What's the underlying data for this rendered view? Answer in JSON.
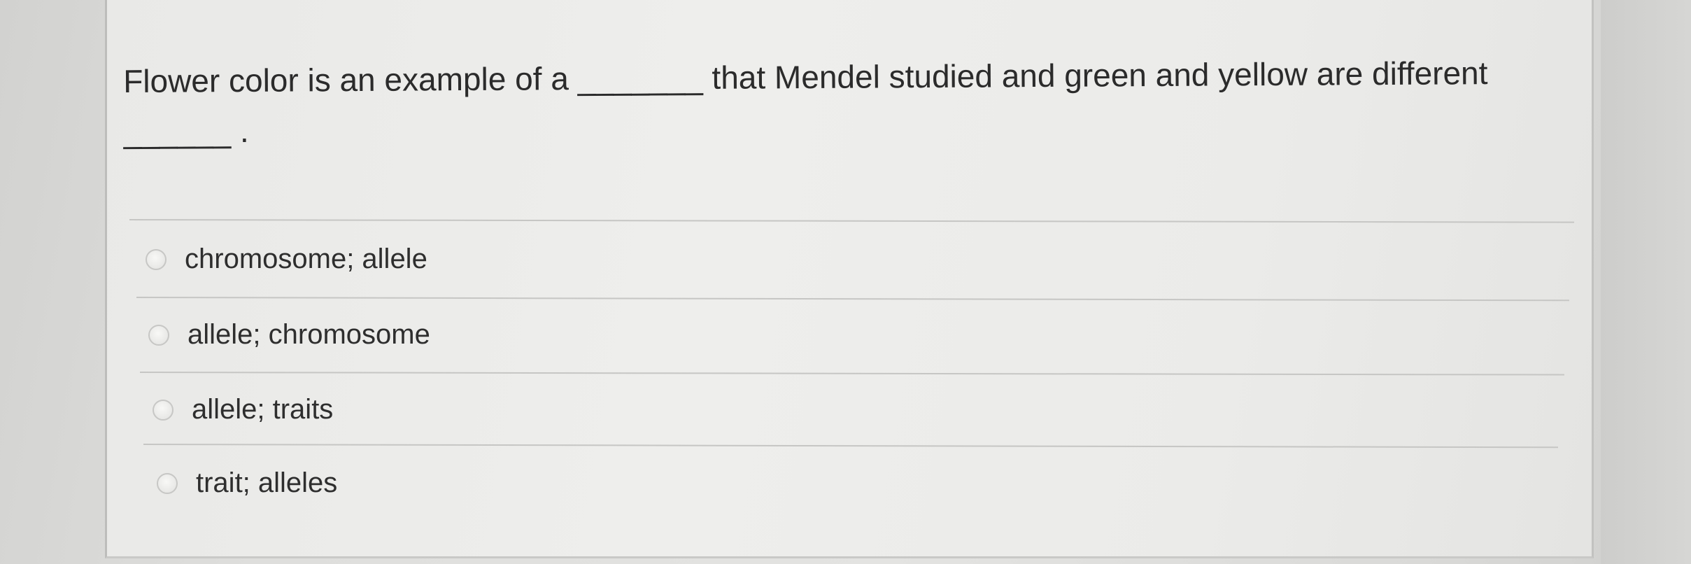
{
  "question": {
    "text": "Flower color is an example of a _______ that Mendel studied and green and yellow are different ______ ."
  },
  "options": [
    {
      "label": "chromosome; allele",
      "selected": false
    },
    {
      "label": "allele; chromosome",
      "selected": false
    },
    {
      "label": "allele; traits",
      "selected": false
    },
    {
      "label": "trait; alleles",
      "selected": false
    }
  ]
}
